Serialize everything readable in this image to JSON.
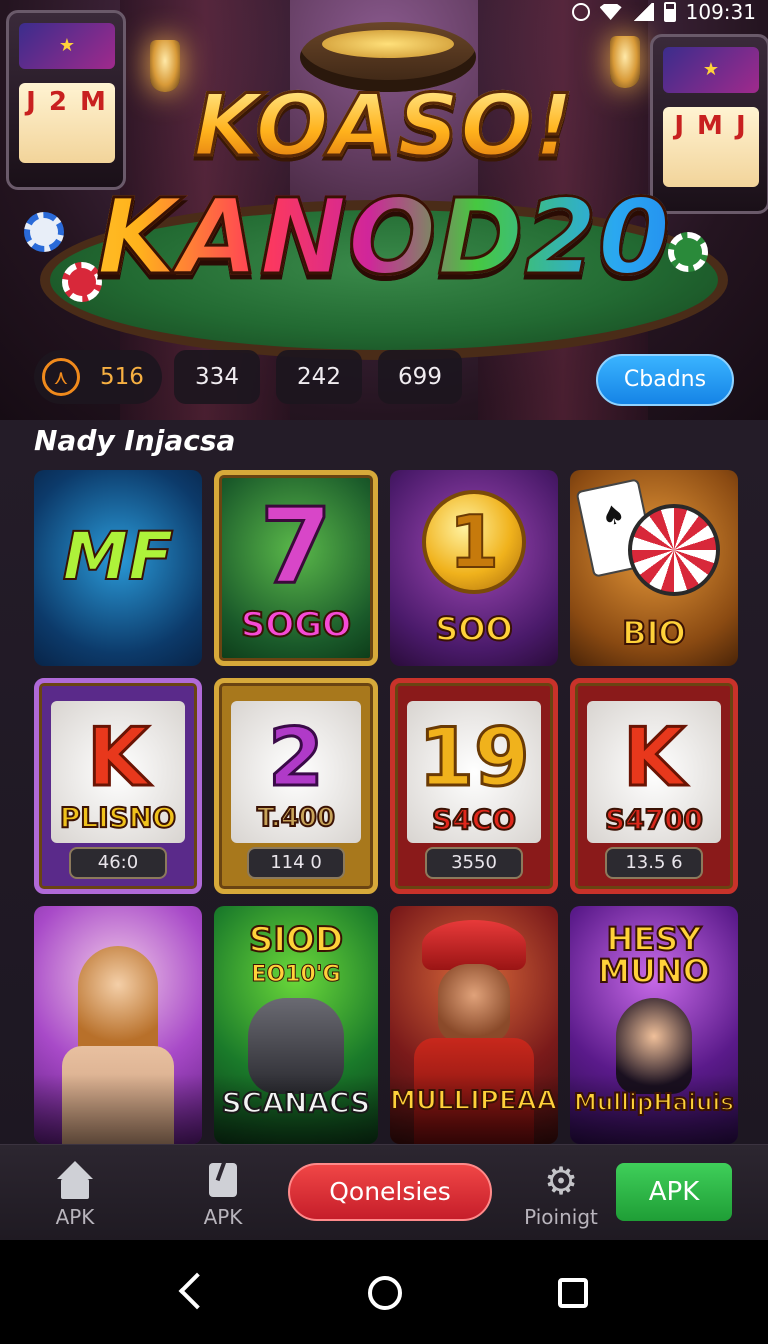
{
  "status_bar": {
    "time": "109:31"
  },
  "hero": {
    "title_line1": "KOASO!",
    "title_line2": "KANOD20"
  },
  "stats": {
    "first_value": "516",
    "values": [
      "334",
      "242",
      "699"
    ],
    "claim_label": "Cbadns"
  },
  "section": {
    "title": "Nady Injacsa"
  },
  "row1": [
    {
      "label": "MF"
    },
    {
      "glyph": "7",
      "label": "SOGO"
    },
    {
      "glyph": "1",
      "label": "SOO"
    },
    {
      "label": "BIO"
    }
  ],
  "row2": [
    {
      "glyph": "K",
      "label": "PLISNO",
      "value": "46:0"
    },
    {
      "glyph": "2",
      "label": "T.400",
      "value": "114 0"
    },
    {
      "glyph": "19",
      "label": "S4CO",
      "value": "3550"
    },
    {
      "glyph": "K",
      "label": "S4700",
      "value": "13.5 6"
    }
  ],
  "row3": [
    {
      "label": ""
    },
    {
      "label_top": "SIOD",
      "label_sub": "EO10'G",
      "label": "SCANACS"
    },
    {
      "label": "MULLIPEAAS"
    },
    {
      "label_top": "HESY",
      "label_sub": "MUNO",
      "label": "MullipHaiuis"
    }
  ],
  "bottom_nav": {
    "home_label": "APK",
    "doc_label": "APK",
    "center_button": "Qonelsies",
    "settings_label": "Pioinigt",
    "apk_button": "APK"
  },
  "colors": {
    "accent_blue": "#1f94f2",
    "accent_red": "#e03a3a",
    "accent_green": "#2fb84a",
    "gold": "#d7a93a"
  },
  "icons": [
    "sync-icon",
    "wifi-icon",
    "signal-icon",
    "battery-icon",
    "timer-icon",
    "home-icon",
    "document-icon",
    "gear-icon",
    "back-icon",
    "home-circle-icon",
    "recents-icon"
  ]
}
